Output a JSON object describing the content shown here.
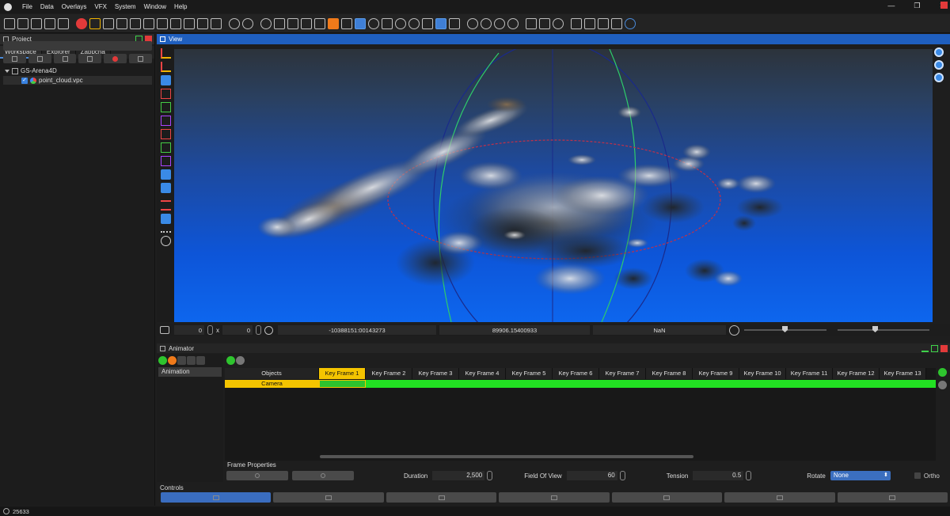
{
  "menubar": {
    "items": [
      "File",
      "Data",
      "Overlays",
      "VFX",
      "System",
      "Window",
      "Help"
    ],
    "window_controls": [
      "—",
      "❐",
      "✕"
    ]
  },
  "project": {
    "title": "Project",
    "tabs": [
      "Workspace",
      "Explorer",
      "Zappcha"
    ],
    "active_tab": "Workspace",
    "tree": {
      "root": "GS-Arena4D",
      "child": "point_cloud.vpc",
      "child_checked": true
    }
  },
  "view": {
    "title": "View",
    "status": {
      "x_value": "0",
      "x_label": "x",
      "y_value": "0",
      "coord_a": "-10388151:00143273",
      "coord_b": "89906.15400933",
      "coord_c": "NaN"
    }
  },
  "animator": {
    "title": "Animator",
    "list_item": "Animation",
    "columns": [
      "Objects",
      "Key Frame 1",
      "Key Frame 2",
      "Key Frame 3",
      "Key Frame 4",
      "Key Frame 5",
      "Key Frame 6",
      "Key Frame 7",
      "Key Frame 8",
      "Key Frame 9",
      "Key Frame 10",
      "Key Frame 11",
      "Key Frame 12",
      "Key Frame 13"
    ],
    "row_object": "Camera",
    "frame_properties": {
      "label": "Frame Properties",
      "duration_label": "Duration",
      "duration_value": "2,500",
      "fov_label": "Field Of View",
      "fov_value": "60",
      "tension_label": "Tension",
      "tension_value": "0.5",
      "rotate_label": "Rotate",
      "rotate_value": "None",
      "ortho_label": "Ortho"
    },
    "controls_label": "Controls"
  },
  "footer": {
    "count": "25633"
  },
  "colors": {
    "accent": "#1f5fbf",
    "keyframe": "#f4c400",
    "track": "#22e022",
    "close": "#e23a3a"
  }
}
